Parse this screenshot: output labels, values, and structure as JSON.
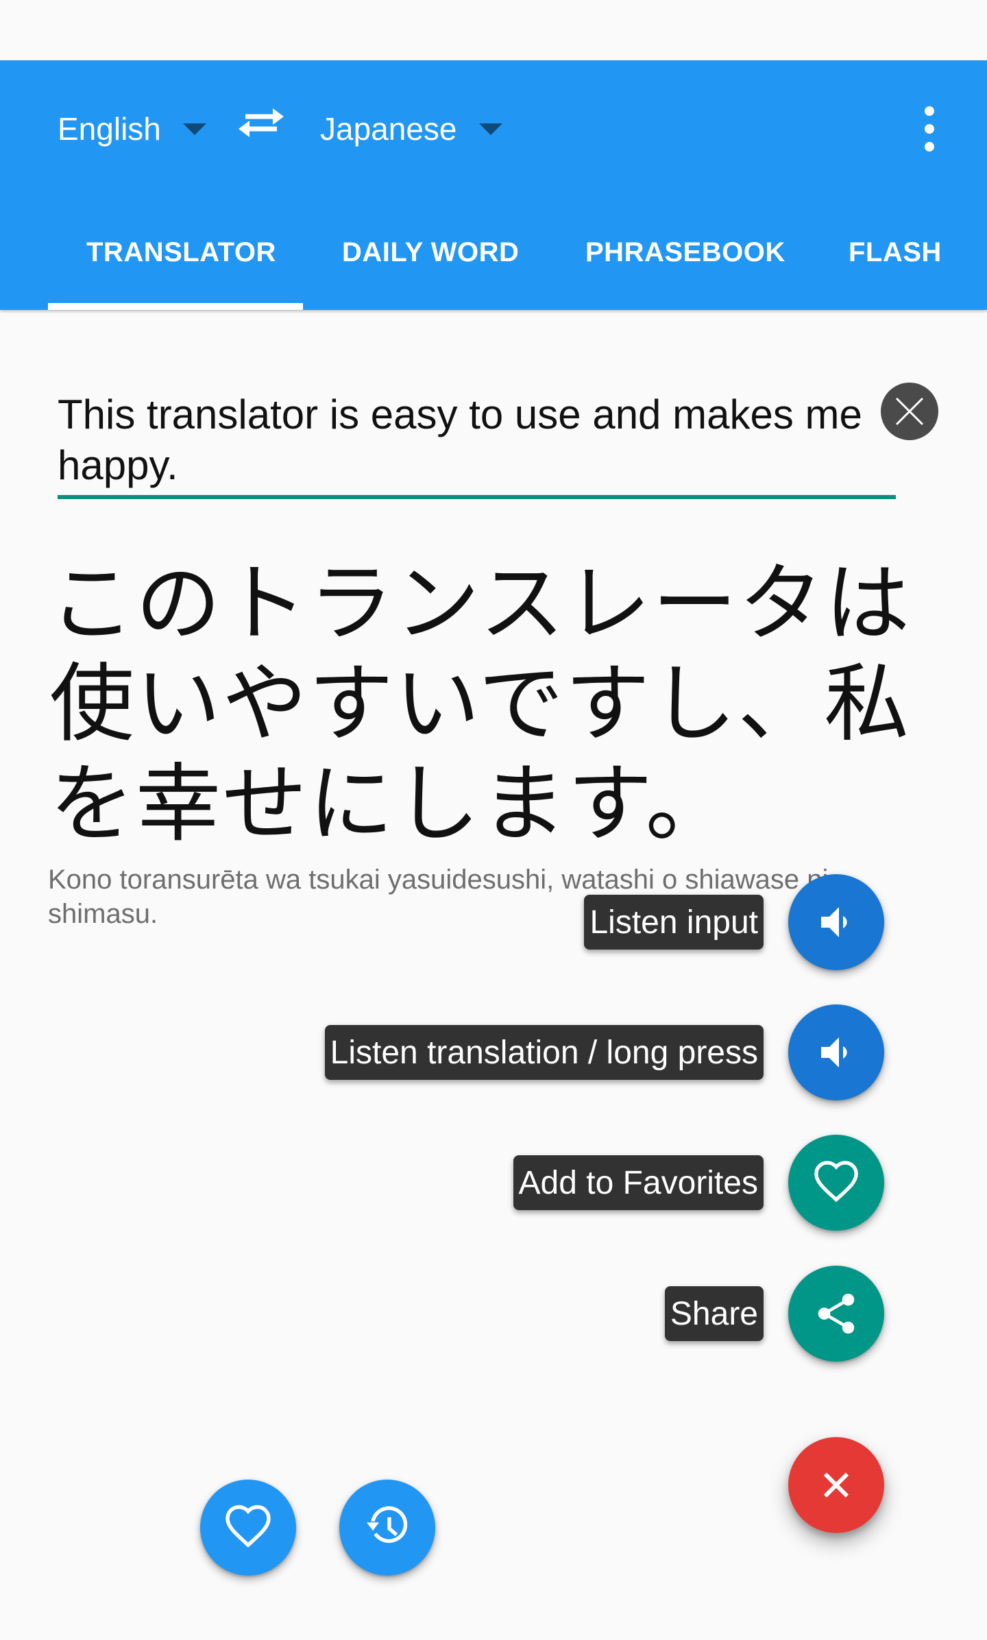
{
  "header": {
    "source_language": "English",
    "target_language": "Japanese",
    "swap_icon": "swap-horiz-icon",
    "menu_icon": "more-vert-icon"
  },
  "tabs": [
    {
      "label": "TRANSLATOR",
      "active": true
    },
    {
      "label": "DAILY WORD",
      "active": false
    },
    {
      "label": "PHRASEBOOK",
      "active": false
    },
    {
      "label": "FLASH",
      "active": false
    }
  ],
  "input": {
    "value": "This translator is easy to use and makes me happy.",
    "clear_icon": "close-icon"
  },
  "translation": {
    "text": "このトランスレータは使いやすいですし、私を幸せにします。",
    "romanization": "Kono toransurēta wa tsukai yasuidesushi, watashi o shiawase ni shimasu."
  },
  "speed_dial": {
    "actions": [
      {
        "label": "Listen input",
        "icon": "volume-icon",
        "color": "#1976d2"
      },
      {
        "label": "Listen translation / long press",
        "icon": "volume-icon",
        "color": "#1976d2"
      },
      {
        "label": "Add to Favorites",
        "icon": "heart-outline-icon",
        "color": "#009688"
      },
      {
        "label": "Share",
        "icon": "share-icon",
        "color": "#009688"
      }
    ],
    "close_icon": "close-icon",
    "close_color": "#e53935"
  },
  "bottom_buttons": [
    {
      "name": "favorites",
      "icon": "heart-outline-icon"
    },
    {
      "name": "history",
      "icon": "history-icon"
    }
  ],
  "colors": {
    "primary": "#2196f3",
    "accent_underline": "#0e8c7e"
  }
}
